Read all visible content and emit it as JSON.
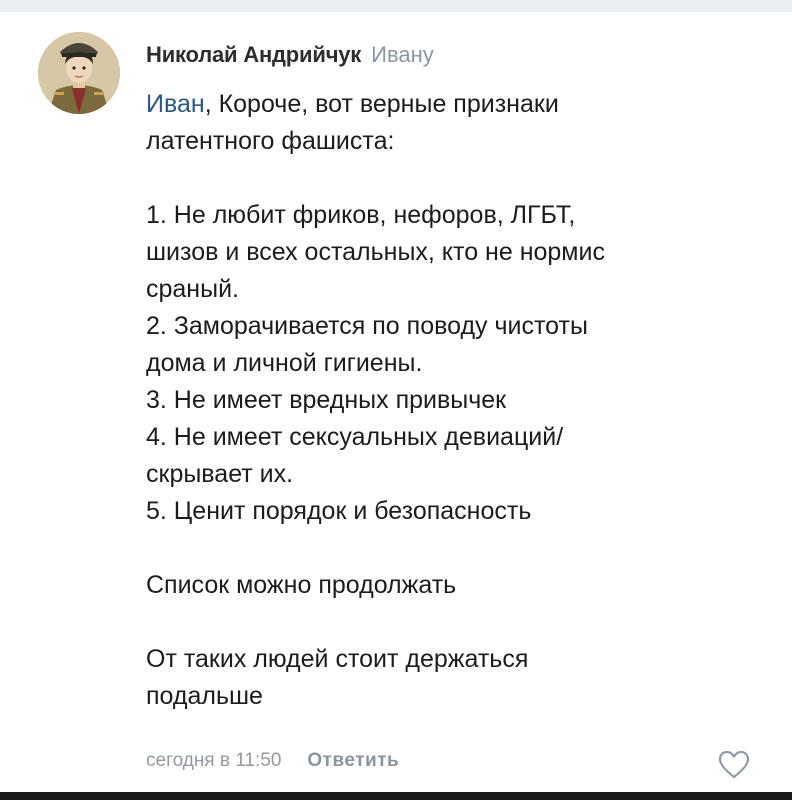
{
  "comment": {
    "author": "Николай Андрийчук",
    "reply_to": "Ивану",
    "mention": "Иван",
    "body_lines": [
      ", Короче, вот верные признаки",
      "латентного фашиста:",
      "",
      "1. Не любит фриков, нефоров, ЛГБТ,",
      "шизов и всех остальных, кто не нормис",
      "сраный.",
      "2. Заморачивается по поводу чистоты",
      "дома и личной гигиены.",
      "3. Не имеет вредных привычек",
      "4. Не имеет сексуальных девиаций/",
      "скрывает их.",
      "5. Ценит порядок и безопасность",
      "",
      "Список можно продолжать",
      "",
      "От таких людей стоит держаться",
      "подальше"
    ],
    "timestamp": "сегодня в 11:50",
    "reply_label": "Ответить",
    "like_icon": "heart-icon",
    "avatar_icon": "avatar-portrait"
  },
  "colors": {
    "author": "#2c2d2e",
    "reply_to": "#8a96a3",
    "mention": "#2a5885",
    "text": "#1c1c1c",
    "meta": "#939aa3"
  }
}
